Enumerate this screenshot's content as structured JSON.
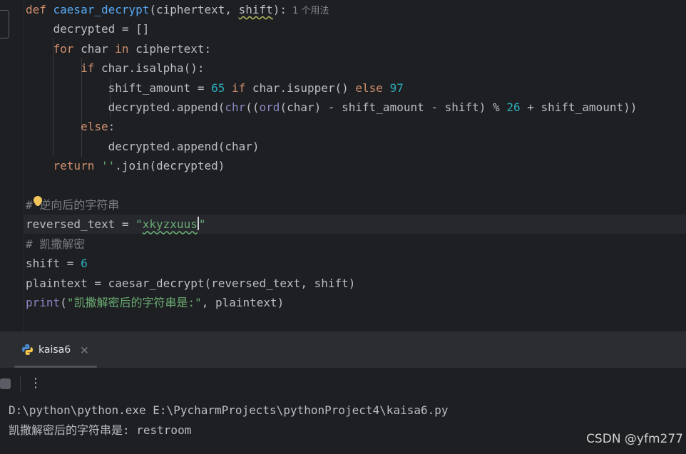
{
  "editor": {
    "lines": [
      {
        "parts": [
          {
            "t": "def ",
            "c": "kw"
          },
          {
            "t": "caesar_decrypt",
            "c": "fn"
          },
          {
            "t": "(ciphertext, "
          },
          {
            "t": "shift",
            "c": "param"
          },
          {
            "t": "):"
          }
        ]
      },
      {
        "parts": [
          {
            "t": "    decrypted = []"
          }
        ]
      },
      {
        "parts": [
          {
            "t": "    "
          },
          {
            "t": "for ",
            "c": "kw"
          },
          {
            "t": "char "
          },
          {
            "t": "in ",
            "c": "kw"
          },
          {
            "t": "ciphertext:"
          }
        ]
      },
      {
        "parts": [
          {
            "t": "        "
          },
          {
            "t": "if ",
            "c": "kw"
          },
          {
            "t": "char.isalpha():"
          }
        ]
      },
      {
        "parts": [
          {
            "t": "            shift_amount = "
          },
          {
            "t": "65 ",
            "c": "num"
          },
          {
            "t": "if ",
            "c": "kw"
          },
          {
            "t": "char.isupper() "
          },
          {
            "t": "else ",
            "c": "kw"
          },
          {
            "t": "97",
            "c": "num"
          }
        ]
      },
      {
        "parts": [
          {
            "t": "            decrypted.append("
          },
          {
            "t": "chr",
            "c": "bi"
          },
          {
            "t": "(("
          },
          {
            "t": "ord",
            "c": "bi"
          },
          {
            "t": "(char) - shift_amount - shift) % "
          },
          {
            "t": "26",
            "c": "num"
          },
          {
            "t": " + shift_amount))"
          }
        ]
      },
      {
        "parts": [
          {
            "t": "        "
          },
          {
            "t": "else",
            "c": "kw"
          },
          {
            "t": ":"
          }
        ]
      },
      {
        "parts": [
          {
            "t": "            decrypted.append(char)"
          }
        ]
      },
      {
        "parts": [
          {
            "t": "    "
          },
          {
            "t": "return ",
            "c": "kw"
          },
          {
            "t": "''",
            "c": "str"
          },
          {
            "t": ".join(decrypted)"
          }
        ]
      },
      {
        "parts": []
      },
      {
        "parts": [
          {
            "t": "# 逆向后的字符串",
            "c": "com"
          }
        ]
      },
      {
        "parts": [
          {
            "t": "reversed_text = "
          },
          {
            "t": "\"",
            "c": "str"
          },
          {
            "t": "xkyzxuus",
            "c": "str typo"
          },
          {
            "t": "",
            "c": "caret"
          },
          {
            "t": "\"",
            "c": "str"
          }
        ]
      },
      {
        "parts": [
          {
            "t": "# 凯撒解密",
            "c": "com"
          }
        ]
      },
      {
        "parts": [
          {
            "t": "shift = "
          },
          {
            "t": "6",
            "c": "num"
          }
        ]
      },
      {
        "parts": [
          {
            "t": "plaintext = caesar_decrypt(reversed_text, shift)"
          }
        ]
      },
      {
        "parts": [
          {
            "t": "print",
            "c": "bi"
          },
          {
            "t": "(",
            "c": ""
          },
          {
            "t": "\"凯撒解密后的字符串是:\"",
            "c": "str"
          },
          {
            "t": ", plaintext)"
          }
        ]
      }
    ],
    "usage_hint": "1 个用法"
  },
  "run_panel": {
    "tab_label": "kaisa6",
    "close_glyph": "×",
    "more_glyph": "⋮"
  },
  "console": {
    "lines": [
      "D:\\python\\python.exe E:\\PycharmProjects\\pythonProject4\\kaisa6.py",
      "凯撒解密后的字符串是: restroom"
    ]
  },
  "watermark": "CSDN @yfm277",
  "colors": {
    "keyword": "#cf8e6d",
    "function": "#56a8f5",
    "number": "#2aacb8",
    "string": "#6aab73",
    "comment": "#7a7e85",
    "builtin": "#8888c6"
  }
}
